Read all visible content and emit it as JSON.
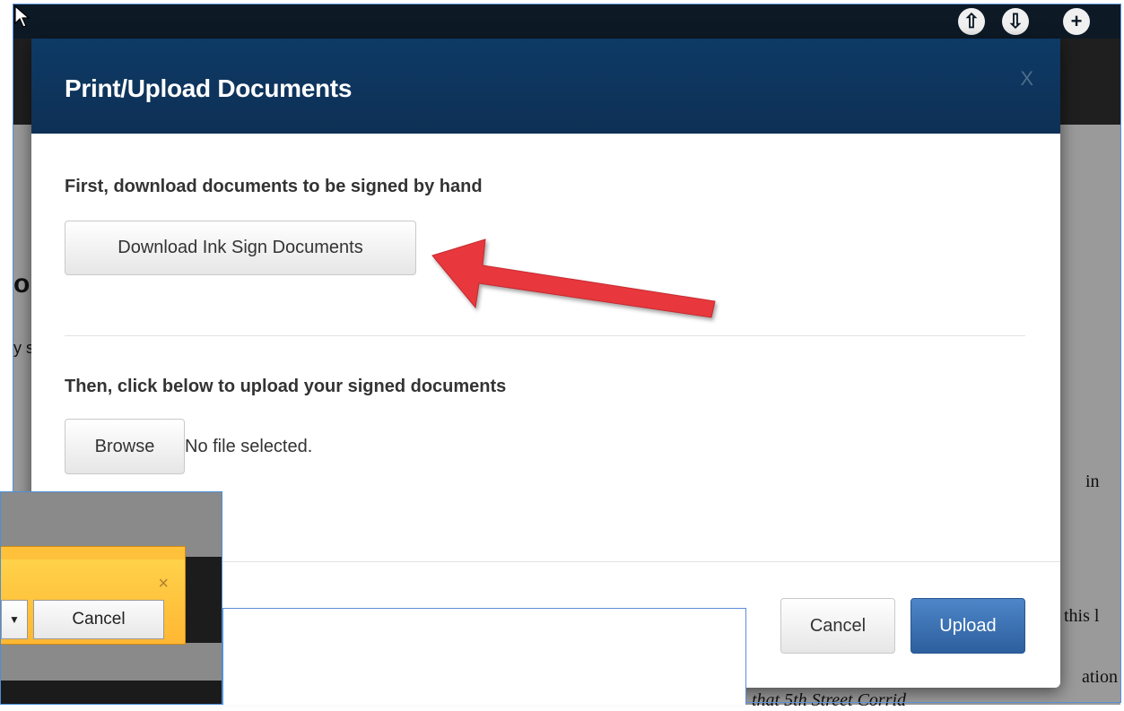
{
  "background": {
    "top_icons": [
      "up-arrow-circle-icon",
      "down-arrow-circle-icon",
      "plus-circle-icon"
    ],
    "fragment_left_heading": "o",
    "fragment_left_text": "y s",
    "fragment_right_1": "in",
    "fragment_right_2": "this l",
    "fragment_right_3": "ation",
    "fragment_right_4": "that 5th Street Corrid"
  },
  "modal": {
    "title": "Print/Upload Documents",
    "close_label": "X",
    "step1_heading": "First, download documents to be signed by hand",
    "download_button": "Download Ink Sign Documents",
    "step2_heading": "Then, click below to upload your signed documents",
    "browse_button": "Browse",
    "file_status": "No file selected.",
    "cancel_button": "Cancel",
    "upload_button": "Upload"
  },
  "annotation": {
    "arrow_color": "#e8383d"
  },
  "overlay": {
    "close_label": "×",
    "dropdown_glyph": "▼",
    "cancel_button": "Cancel"
  },
  "colors": {
    "modal_header": "#0e3055",
    "primary_button": "#2d5f9e"
  }
}
